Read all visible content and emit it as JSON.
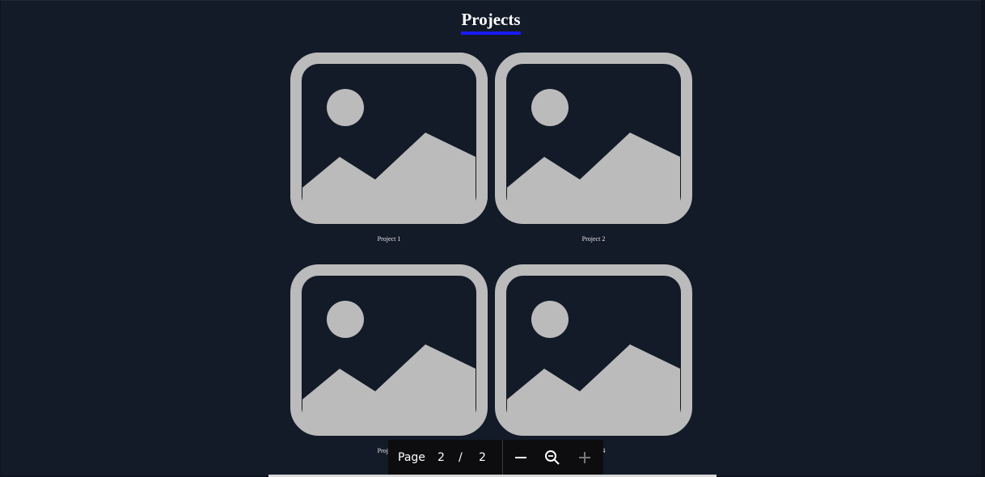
{
  "header": {
    "title": "Projects"
  },
  "colors": {
    "background": "#131a28",
    "placeholder": "#bbbbbb",
    "title_underline": "#1a1aff"
  },
  "projects": [
    {
      "label": "Project 1",
      "icon": "image-placeholder-icon"
    },
    {
      "label": "Project 2",
      "icon": "image-placeholder-icon"
    },
    {
      "label": "Project 3",
      "icon": "image-placeholder-icon"
    },
    {
      "label": "Project 4",
      "icon": "image-placeholder-icon"
    }
  ],
  "viewer": {
    "page_label": "Page",
    "current_page": "2",
    "separator": "/",
    "total_pages": "2",
    "icons": [
      "minus-icon",
      "zoom-out-icon",
      "plus-icon"
    ]
  }
}
